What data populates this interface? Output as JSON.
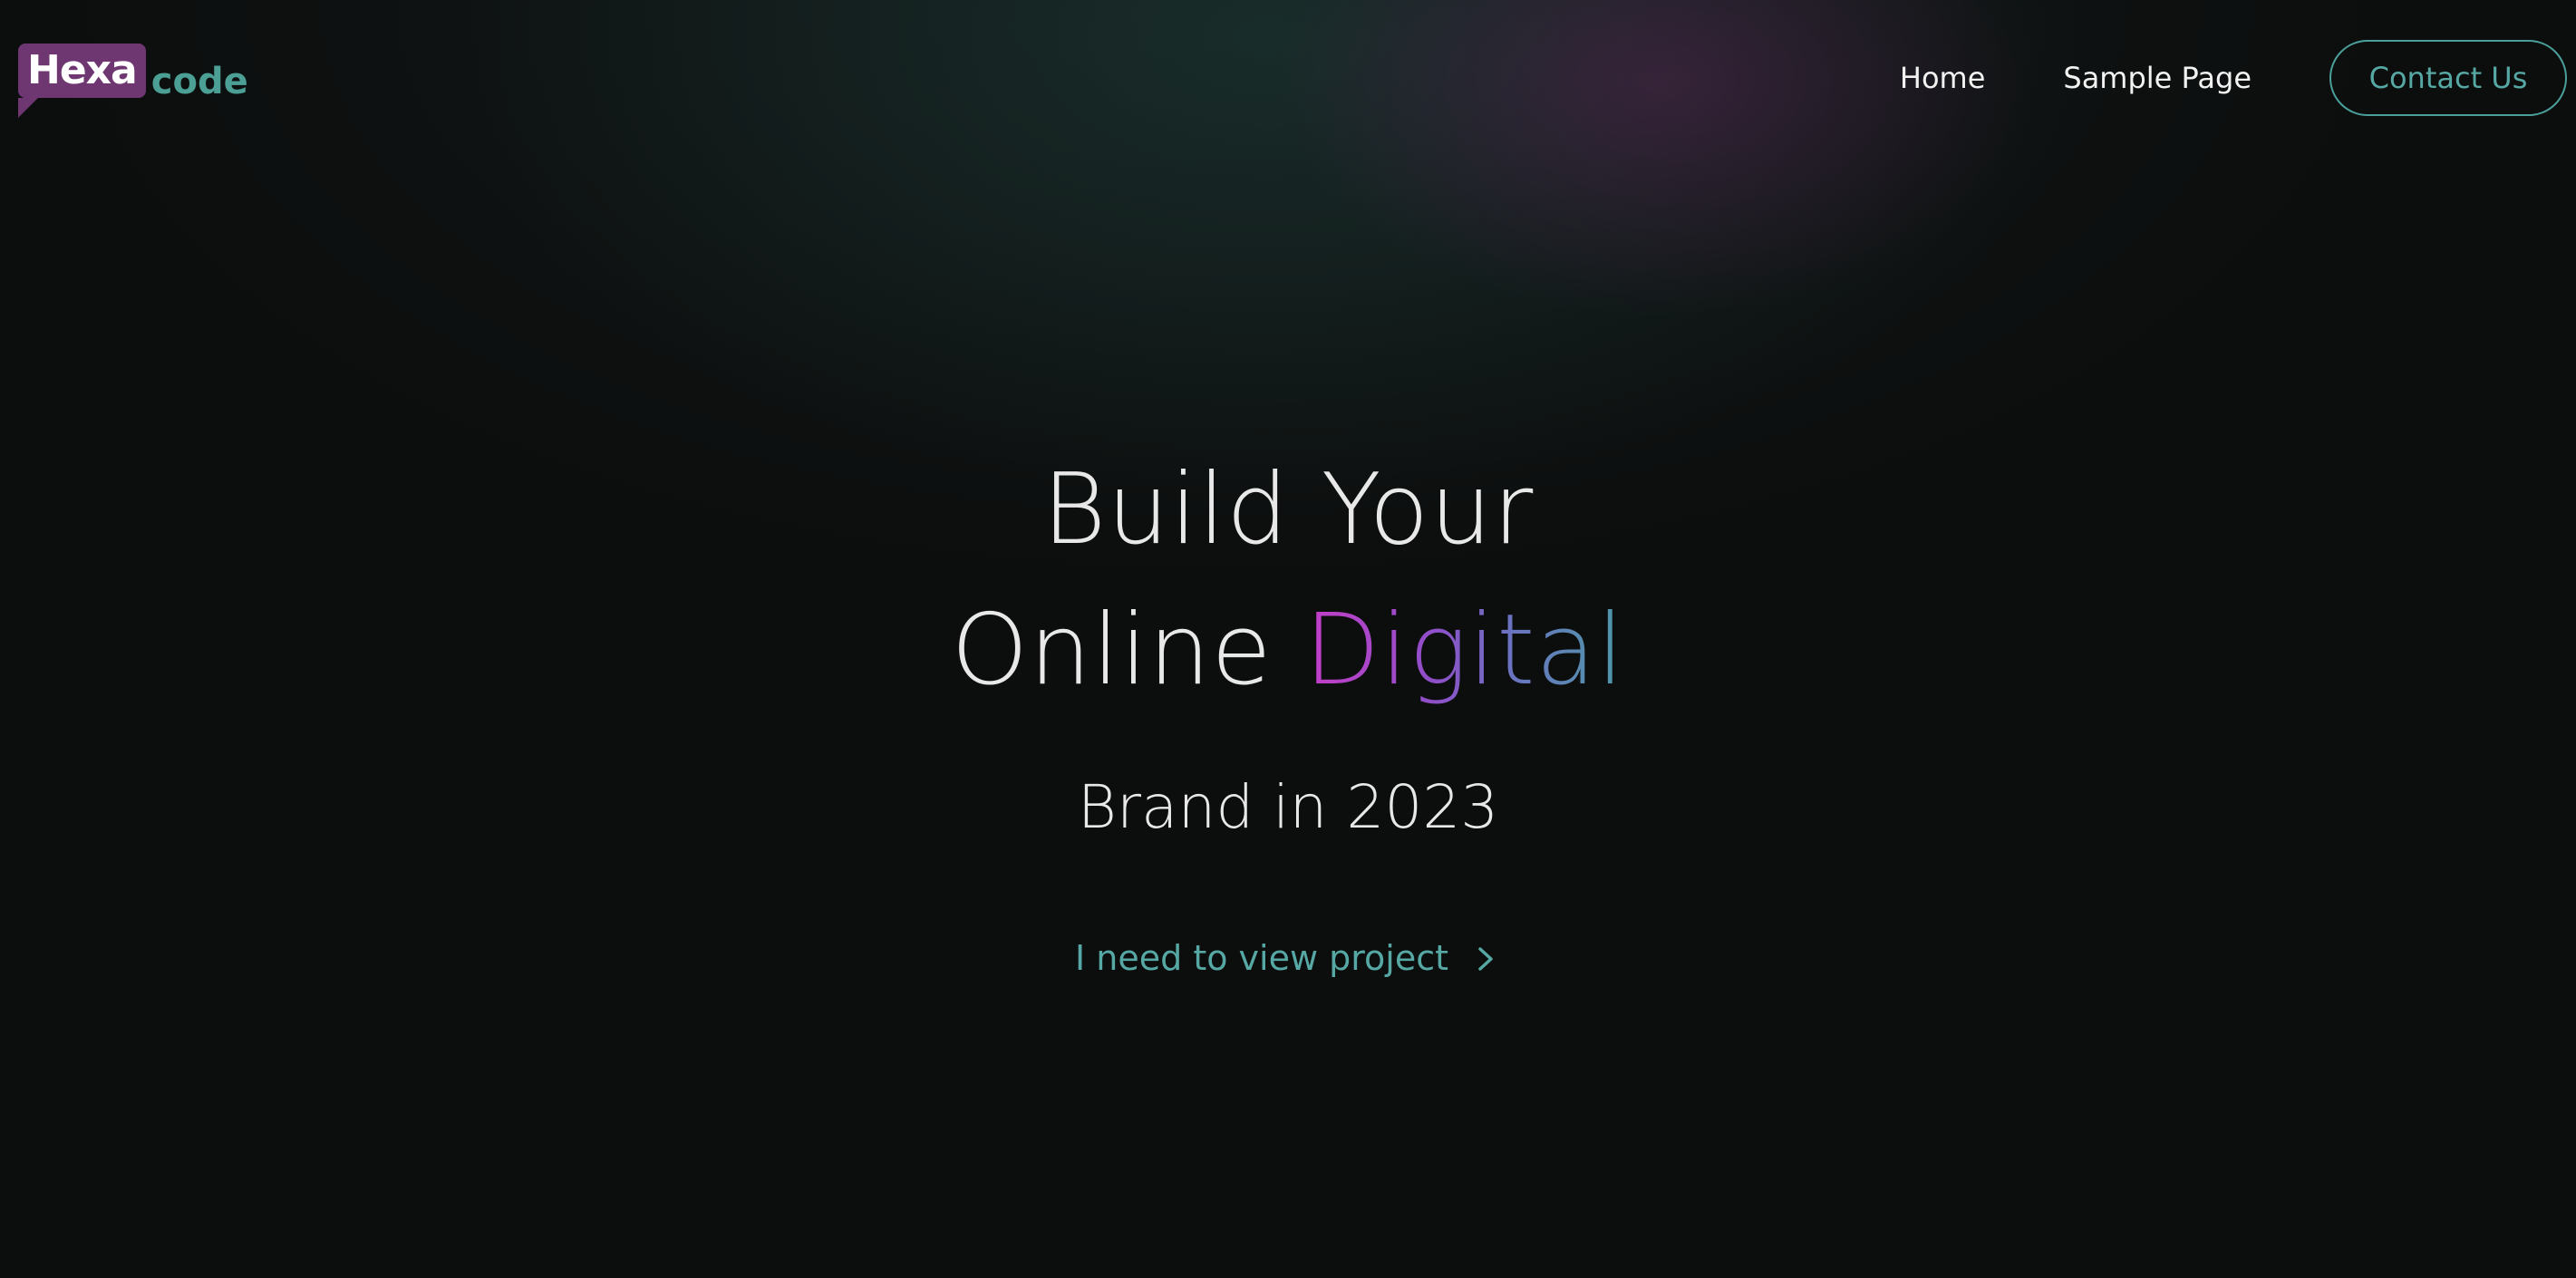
{
  "brand": {
    "logo_primary": "Hexa",
    "logo_secondary": "code",
    "colors": {
      "logo_bg": "#6e3771",
      "logo_secondary": "#4b9f95",
      "accent_teal": "#56a8a4",
      "gradient_start": "#c43ec8",
      "gradient_end": "#4d98a6"
    }
  },
  "nav": {
    "items": [
      {
        "label": "Home"
      },
      {
        "label": "Sample Page"
      }
    ],
    "contact_label": "Contact Us"
  },
  "hero": {
    "line1": "Build Your",
    "line2_plain": "Online ",
    "line2_highlight": "Digital",
    "line3": "Brand in 2023",
    "cta_label": "I need to view project",
    "cta_icon": "chevron-right-icon"
  }
}
